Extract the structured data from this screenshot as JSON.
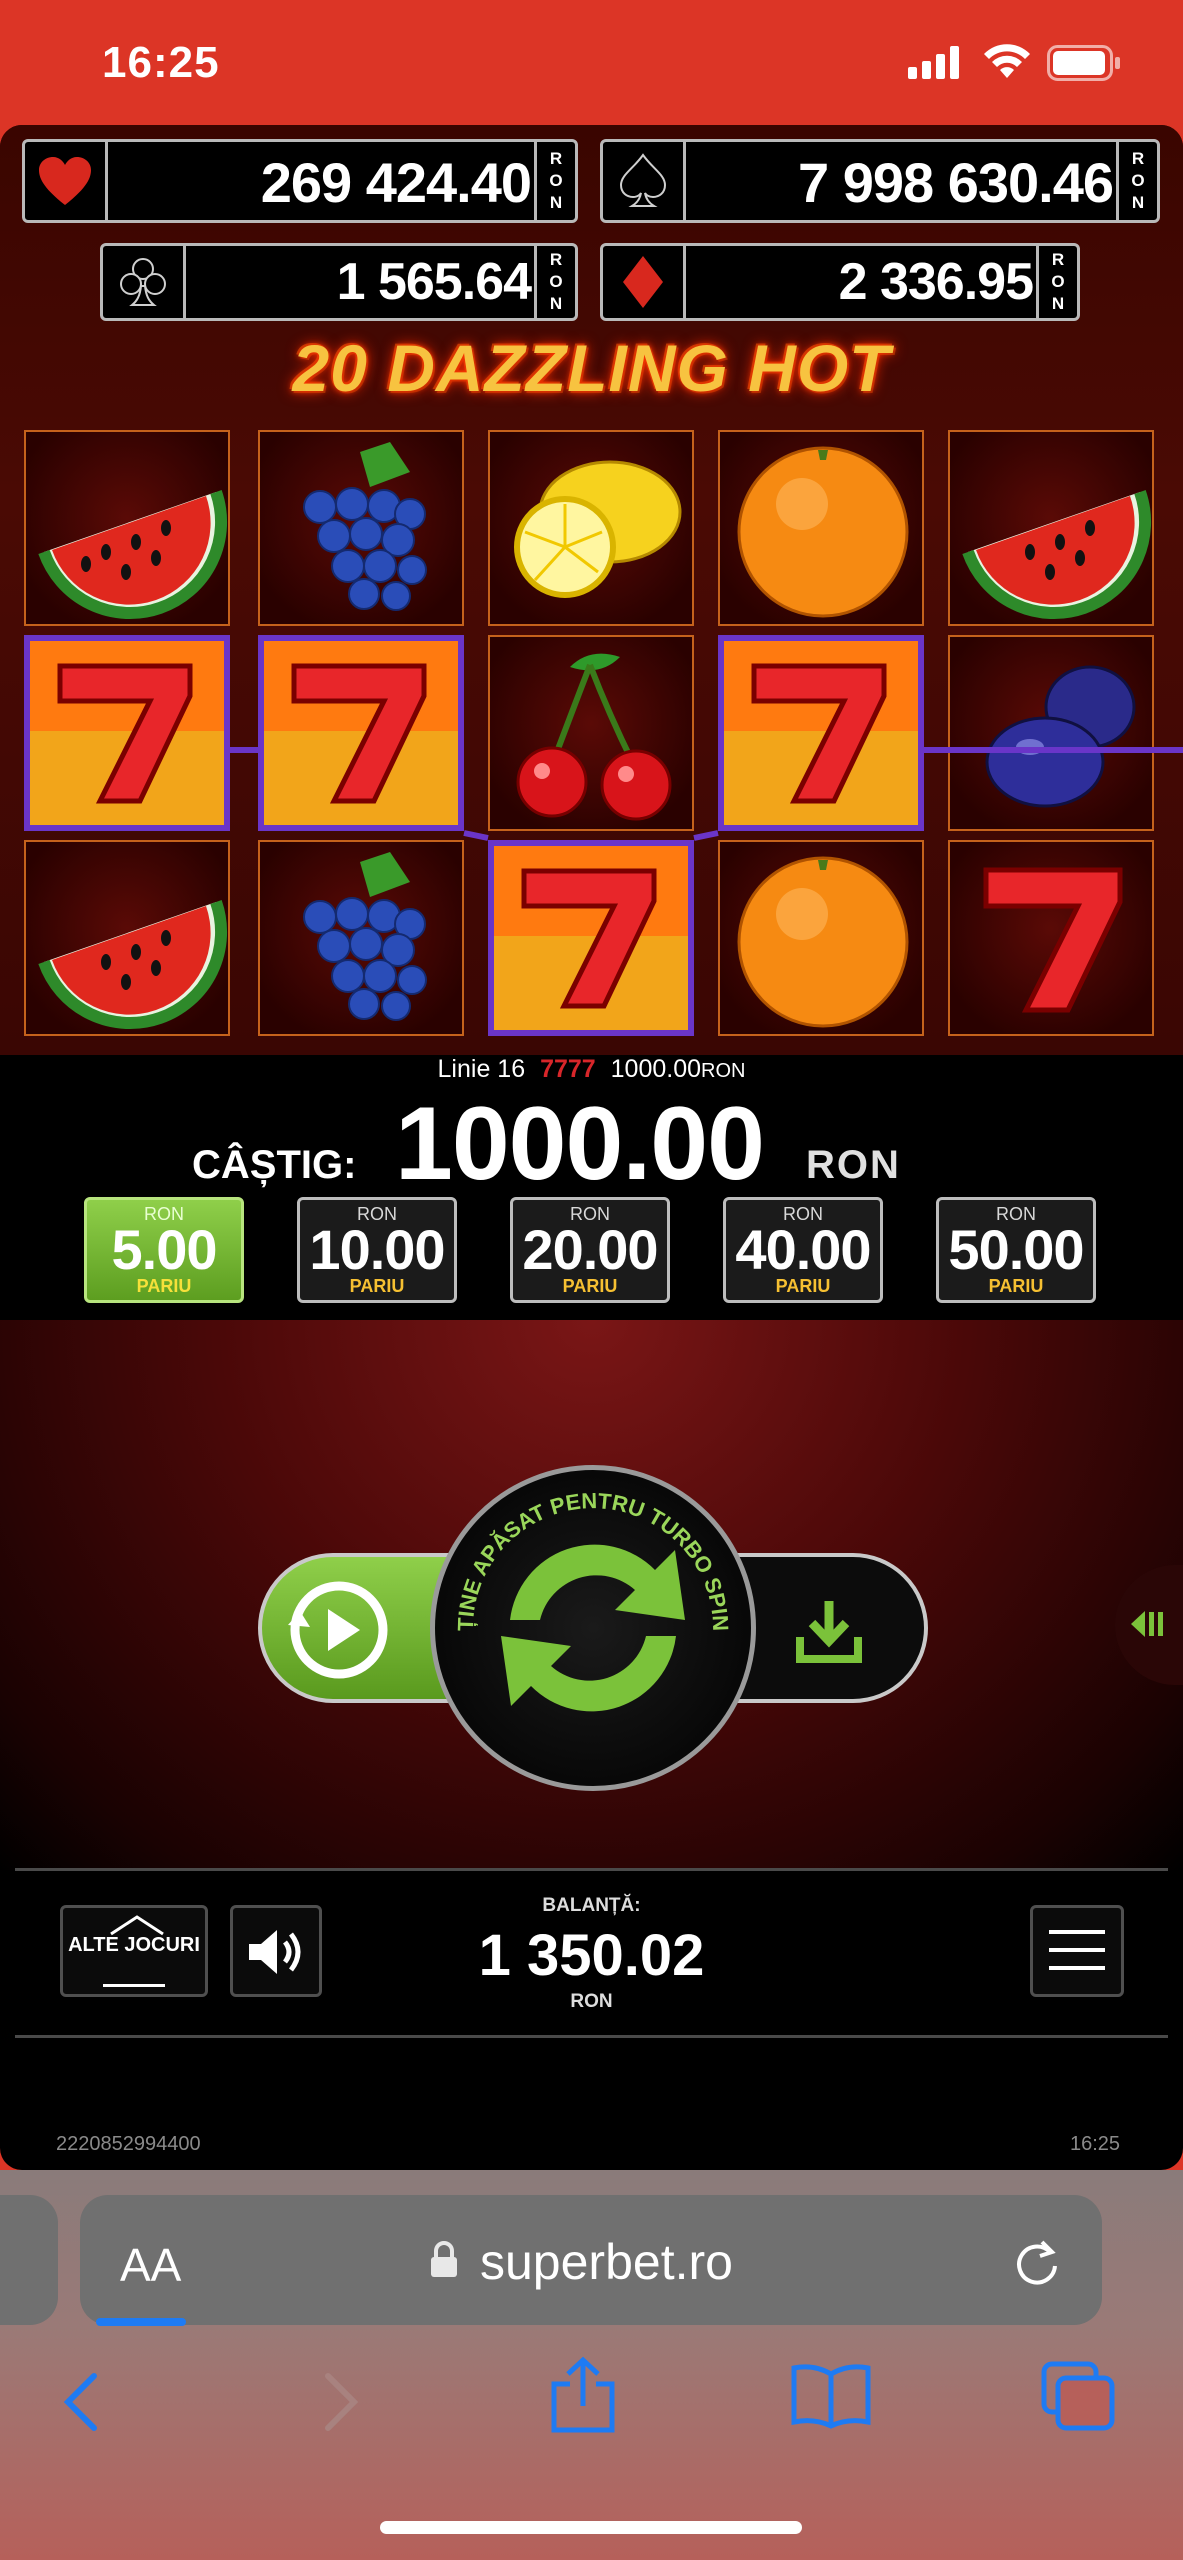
{
  "status_bar": {
    "time": "16:25"
  },
  "jackpots": [
    {
      "suit": "heart-icon",
      "value": "269 424.40",
      "currency": "RON",
      "color": "#d8281e"
    },
    {
      "suit": "spade-icon",
      "value": "7 998 630.46",
      "currency": "RON",
      "color": "#000000"
    },
    {
      "suit": "club-icon",
      "value": "1 565.64",
      "currency": "RON",
      "color": "#000000"
    },
    {
      "suit": "diamond-icon",
      "value": "2 336.95",
      "currency": "RON",
      "color": "#d8281e"
    }
  ],
  "game_title": "20 DAZZLING HOT",
  "reels": [
    [
      "watermelon",
      "seven",
      "watermelon"
    ],
    [
      "grapes",
      "seven",
      "grapes"
    ],
    [
      "lemon",
      "cherries",
      "seven"
    ],
    [
      "orange",
      "seven",
      "orange"
    ],
    [
      "watermelon",
      "plums",
      "seven"
    ]
  ],
  "win_line": {
    "label": "Linie 16",
    "amount": "1000.00",
    "currency": "RON"
  },
  "win": {
    "label": "CÂȘTIG:",
    "amount": "1000.00",
    "currency": "RON"
  },
  "bets": [
    {
      "currency": "RON",
      "value": "5.00",
      "label": "PARIU",
      "selected": true
    },
    {
      "currency": "RON",
      "value": "10.00",
      "label": "PARIU",
      "selected": false
    },
    {
      "currency": "RON",
      "value": "20.00",
      "label": "PARIU",
      "selected": false
    },
    {
      "currency": "RON",
      "value": "40.00",
      "label": "PARIU",
      "selected": false
    },
    {
      "currency": "RON",
      "value": "50.00",
      "label": "PARIU",
      "selected": false
    }
  ],
  "spin_button": {
    "hint": "ȚINE APĂSAT PENTRU TURBO SPIN"
  },
  "footer": {
    "other_games_label": "ALTE JOCURI",
    "balance_label": "BALANȚĂ:",
    "balance_value": "1 350.02",
    "balance_currency": "RON",
    "session_id": "2220852994400",
    "time": "16:25"
  },
  "browser": {
    "text_size_label": "AA",
    "url": "superbet.ro"
  },
  "colors": {
    "status_bar": "#dc3526",
    "accent_green": "#7bc23a",
    "win_frame": "#6a35c8"
  }
}
